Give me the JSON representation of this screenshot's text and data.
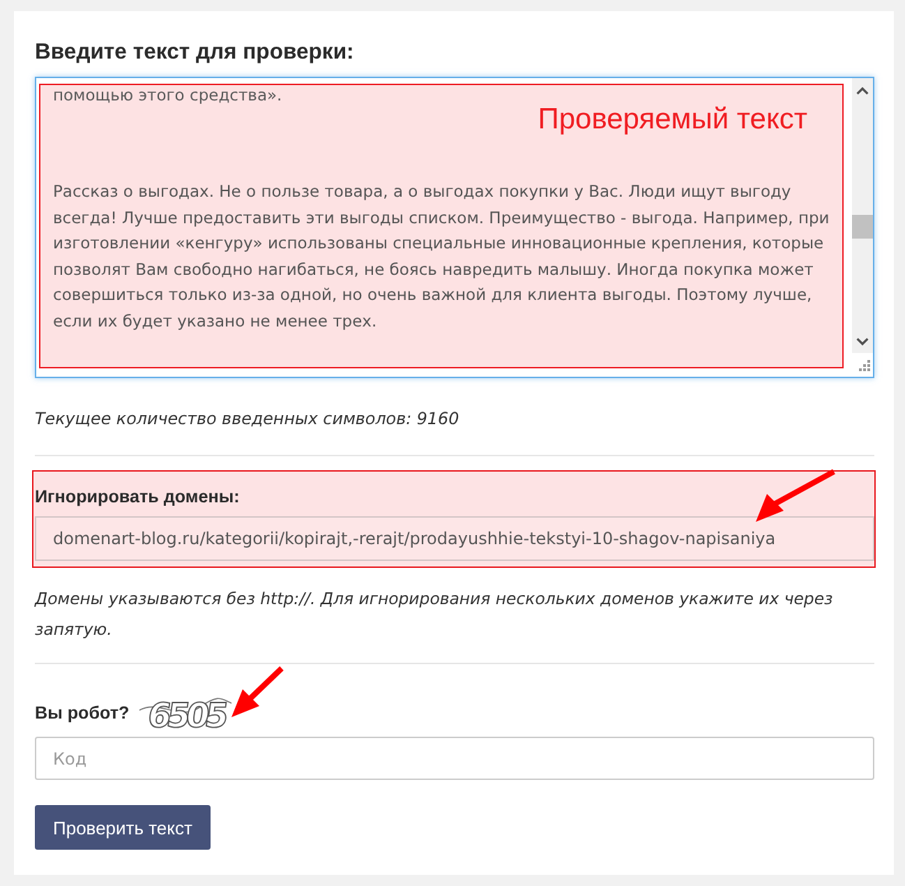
{
  "heading": "Введите текст для проверки:",
  "text_area": {
    "cut_line": "помощью этого средства».",
    "annotation": "Проверяемый текст",
    "value": "Рассказ о выгодах. Не о пользе товара, а о выгодах покупки у Вас. Люди ищут выгоду всегда! Лучше предоставить эти выгоды списком. Преимущество - выгода. Например, при изготовлении «кенгуру» использованы специальные инновационные крепления, которые позволят Вам свободно нагибаться, не боясь навредить малышу. Иногда покупка может совершиться только из-за одной, но очень важной для клиента выгоды. Поэтому лучше, если их будет указано не менее трех."
  },
  "char_count": "Текущее количество введенных символов: 9160",
  "domains": {
    "label": "Игнорировать домены:",
    "value": "domenart-blog.ru/kategorii/kopirajt,-rerajt/prodayushhie-tekstyi-10-shagov-napisaniya",
    "hint": "Домены указываются без http://. Для игнорирования нескольких доменов укажите их через запятую."
  },
  "captcha": {
    "label": "Вы робот?",
    "code": "6505",
    "placeholder": "Код"
  },
  "submit_button": "Проверить текст"
}
